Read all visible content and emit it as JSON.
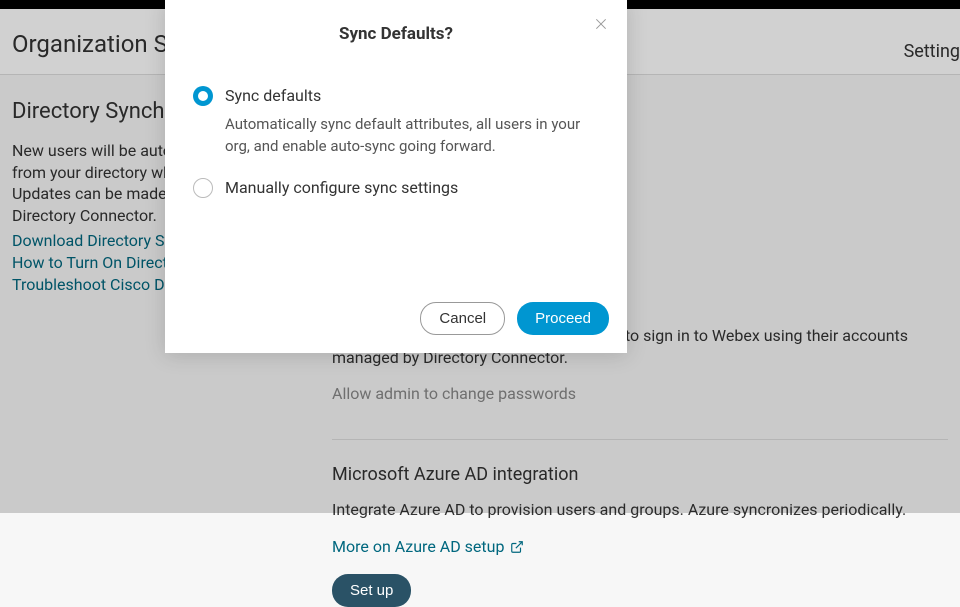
{
  "header": {
    "title": "Organization Settings",
    "right_link": "Setting"
  },
  "sidebar": {
    "heading": "Directory Synchronization",
    "paragraph": "New users will be automatically created from your directory when it synchronizes. Updates can be made directly in Cisco Directory Connector.",
    "links": [
      "Download Directory Sync Client",
      "How to Turn On Directory Synchronization",
      "Troubleshoot Cisco Directory Connector"
    ]
  },
  "content": {
    "paragraph": "Users without Cisco passwords will have to sign in to Webex using their accounts managed by Directory Connector.",
    "muted_link": "Allow admin to change passwords",
    "section_title": "Microsoft Azure AD integration",
    "section_desc": "Integrate Azure AD to provision users and groups. Azure syncronizes periodically.",
    "section_link": "More on Azure AD setup",
    "setup_button": "Set up"
  },
  "modal": {
    "title": "Sync Defaults?",
    "options": [
      {
        "label": "Sync defaults",
        "desc": "Automatically sync default attributes, all users in your org, and enable auto-sync going forward."
      },
      {
        "label": "Manually configure sync settings",
        "desc": ""
      }
    ],
    "cancel": "Cancel",
    "proceed": "Proceed"
  }
}
